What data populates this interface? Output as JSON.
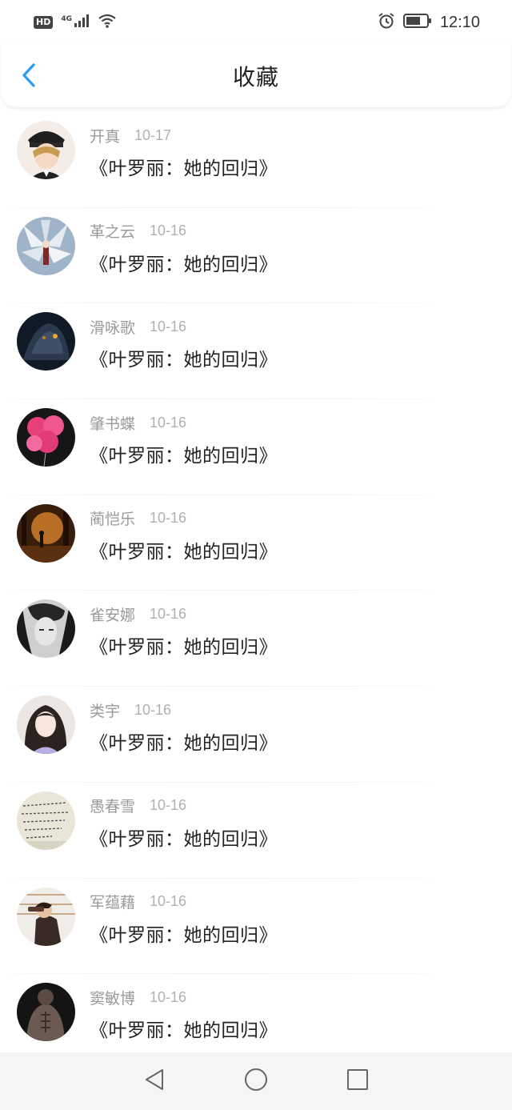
{
  "status_bar": {
    "hd": "HD",
    "network": "4G",
    "time": "12:10"
  },
  "header": {
    "title": "收藏",
    "accent_color": "#2a9df4"
  },
  "items": [
    {
      "name": "开真",
      "date": "10-17",
      "title": "《叶罗丽：她的回归》"
    },
    {
      "name": "革之云",
      "date": "10-16",
      "title": "《叶罗丽：她的回归》"
    },
    {
      "name": "滑咏歌",
      "date": "10-16",
      "title": "《叶罗丽：她的回归》"
    },
    {
      "name": "肇书蝶",
      "date": "10-16",
      "title": "《叶罗丽：她的回归》"
    },
    {
      "name": "蔺恺乐",
      "date": "10-16",
      "title": "《叶罗丽：她的回归》"
    },
    {
      "name": "雀安娜",
      "date": "10-16",
      "title": "《叶罗丽：她的回归》"
    },
    {
      "name": "类宇",
      "date": "10-16",
      "title": "《叶罗丽：她的回归》"
    },
    {
      "name": "愚春雪",
      "date": "10-16",
      "title": "《叶罗丽：她的回归》"
    },
    {
      "name": "军蕴藉",
      "date": "10-16",
      "title": "《叶罗丽：她的回归》"
    },
    {
      "name": "窦敏博",
      "date": "10-16",
      "title": "《叶罗丽：她的回归》"
    }
  ]
}
